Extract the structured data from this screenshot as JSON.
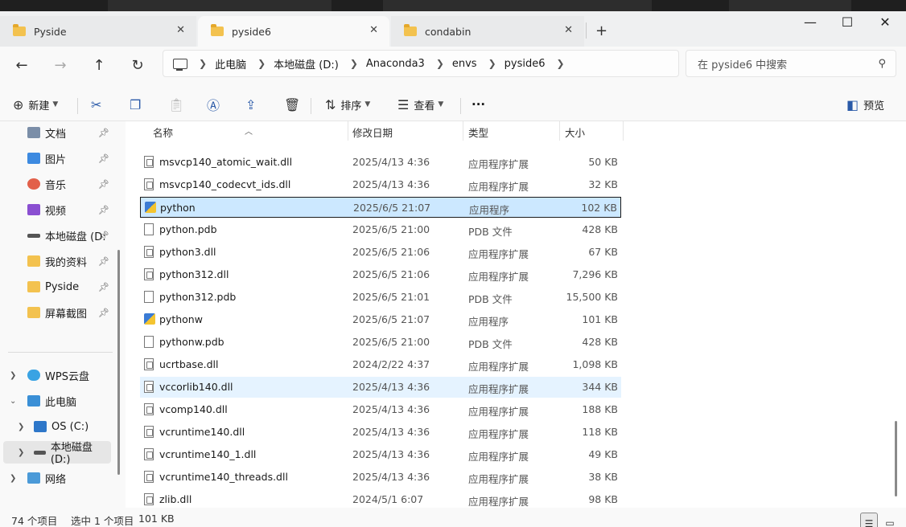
{
  "tabs": [
    {
      "label": "Pyside",
      "active": false
    },
    {
      "label": "pyside6",
      "active": true
    },
    {
      "label": "condabin",
      "active": false
    }
  ],
  "window_controls": {
    "minimize": "—",
    "maximize": "☐",
    "close": "✕"
  },
  "breadcrumb": [
    "此电脑",
    "本地磁盘 (D:)",
    "Anaconda3",
    "envs",
    "pyside6"
  ],
  "search": {
    "placeholder": "在 pyside6 中搜索"
  },
  "toolbar": {
    "new_label": "新建",
    "sort_label": "排序",
    "view_label": "查看",
    "more_label": "···",
    "preview_label": "预览"
  },
  "nav": {
    "quick": [
      {
        "label": "文档",
        "icon": "document-icon"
      },
      {
        "label": "图片",
        "icon": "picture-icon"
      },
      {
        "label": "音乐",
        "icon": "music-icon"
      },
      {
        "label": "视频",
        "icon": "video-icon"
      },
      {
        "label": "本地磁盘 (D:",
        "icon": "drive-icon"
      },
      {
        "label": "我的资料",
        "icon": "folder-icon"
      },
      {
        "label": "Pyside",
        "icon": "folder-icon"
      },
      {
        "label": "屏幕截图",
        "icon": "folder-icon"
      }
    ],
    "tree": [
      {
        "label": "WPS云盘",
        "expanded": false
      },
      {
        "label": "此电脑",
        "expanded": true
      },
      {
        "label": "OS (C:)",
        "expanded": false
      },
      {
        "label": "本地磁盘 (D:)",
        "expanded": false
      },
      {
        "label": "网络",
        "expanded": false
      }
    ]
  },
  "columns": {
    "name": "名称",
    "date": "修改日期",
    "type": "类型",
    "size": "大小"
  },
  "files": [
    {
      "name": "msvcp140_atomic_wait.dll",
      "date": "2025/4/13 4:36",
      "type": "应用程序扩展",
      "size": "50 KB",
      "kind": "dll"
    },
    {
      "name": "msvcp140_codecvt_ids.dll",
      "date": "2025/4/13 4:36",
      "type": "应用程序扩展",
      "size": "32 KB",
      "kind": "dll"
    },
    {
      "name": "python",
      "date": "2025/6/5 21:07",
      "type": "应用程序",
      "size": "102 KB",
      "kind": "exe",
      "state": "selected"
    },
    {
      "name": "python.pdb",
      "date": "2025/6/5 21:00",
      "type": "PDB 文件",
      "size": "428 KB",
      "kind": "file"
    },
    {
      "name": "python3.dll",
      "date": "2025/6/5 21:06",
      "type": "应用程序扩展",
      "size": "67 KB",
      "kind": "dll"
    },
    {
      "name": "python312.dll",
      "date": "2025/6/5 21:06",
      "type": "应用程序扩展",
      "size": "7,296 KB",
      "kind": "dll"
    },
    {
      "name": "python312.pdb",
      "date": "2025/6/5 21:01",
      "type": "PDB 文件",
      "size": "15,500 KB",
      "kind": "file"
    },
    {
      "name": "pythonw",
      "date": "2025/6/5 21:07",
      "type": "应用程序",
      "size": "101 KB",
      "kind": "exe"
    },
    {
      "name": "pythonw.pdb",
      "date": "2025/6/5 21:00",
      "type": "PDB 文件",
      "size": "428 KB",
      "kind": "file"
    },
    {
      "name": "ucrtbase.dll",
      "date": "2024/2/22 4:37",
      "type": "应用程序扩展",
      "size": "1,098 KB",
      "kind": "dll"
    },
    {
      "name": "vccorlib140.dll",
      "date": "2025/4/13 4:36",
      "type": "应用程序扩展",
      "size": "344 KB",
      "kind": "dll",
      "state": "hover"
    },
    {
      "name": "vcomp140.dll",
      "date": "2025/4/13 4:36",
      "type": "应用程序扩展",
      "size": "188 KB",
      "kind": "dll"
    },
    {
      "name": "vcruntime140.dll",
      "date": "2025/4/13 4:36",
      "type": "应用程序扩展",
      "size": "118 KB",
      "kind": "dll"
    },
    {
      "name": "vcruntime140_1.dll",
      "date": "2025/4/13 4:36",
      "type": "应用程序扩展",
      "size": "49 KB",
      "kind": "dll"
    },
    {
      "name": "vcruntime140_threads.dll",
      "date": "2025/4/13 4:36",
      "type": "应用程序扩展",
      "size": "38 KB",
      "kind": "dll"
    },
    {
      "name": "zlib.dll",
      "date": "2024/5/1 6:07",
      "type": "应用程序扩展",
      "size": "98 KB",
      "kind": "dll"
    }
  ],
  "status": {
    "count": "74 个项目",
    "selected": "选中 1 个项目",
    "selected_size": "101 KB"
  },
  "colors": {
    "selection": "#cce8ff",
    "hover": "#e5f3ff",
    "accent": "#2a5aa8"
  }
}
